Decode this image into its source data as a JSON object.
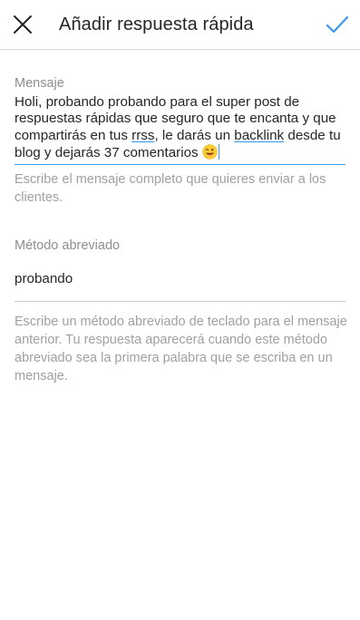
{
  "header": {
    "title": "Añadir respuesta rápida",
    "close_icon": "close-icon",
    "confirm_icon": "checkmark-icon",
    "accent_color": "#3897f0"
  },
  "message": {
    "label": "Mensaje",
    "text_parts": [
      "Holi, probando probando para el super post de respuestas rápidas que seguro que te encanta y que compartirás en tus ",
      "rrss",
      ", le darás un ",
      "backlink",
      " desde tu blog y dejarás 37 comentarios "
    ],
    "emoji": "winking-face-with-tongue",
    "helper": "Escribe el mensaje completo que quieres enviar a los clientes."
  },
  "shortcut": {
    "label": "Método abreviado",
    "value": "probando",
    "helper": "Escribe un método abreviado de teclado para el mensaje anterior. Tu respuesta aparecerá cuando este método abreviado sea la primera palabra que se escriba en un mensaje."
  }
}
